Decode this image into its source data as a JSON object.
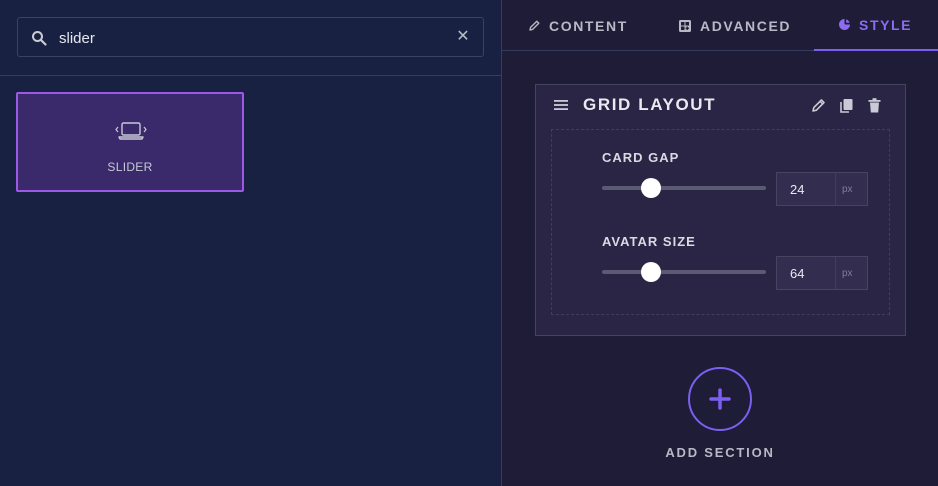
{
  "search": {
    "value": "slider",
    "placeholder": "Search widgets...",
    "icon": "search-icon",
    "clear_icon": "close-icon"
  },
  "widgets": [
    {
      "label": "SLIDER",
      "icon": "laptop-icon"
    }
  ],
  "tabs": [
    {
      "label": "CONTENT",
      "icon": "pencil-icon",
      "active": false
    },
    {
      "label": "ADVANCED",
      "icon": "grid-plus-icon",
      "active": false
    },
    {
      "label": "STYLE",
      "icon": "palette-icon",
      "active": true
    }
  ],
  "section": {
    "title": "GRID LAYOUT",
    "actions": [
      "edit-icon",
      "copy-icon",
      "trash-icon"
    ],
    "fields": [
      {
        "label": "CARD GAP",
        "value": "24",
        "unit": "px",
        "slider_fraction": 0.3
      },
      {
        "label": "AVATAR SIZE",
        "value": "64",
        "unit": "px",
        "slider_fraction": 0.3
      }
    ]
  },
  "add_section": {
    "label": "ADD SECTION"
  },
  "colors": {
    "accent": "#7c5ff0",
    "widget_border": "#9b59e6",
    "left_bg": "#182142",
    "right_bg": "#1e1c36"
  }
}
